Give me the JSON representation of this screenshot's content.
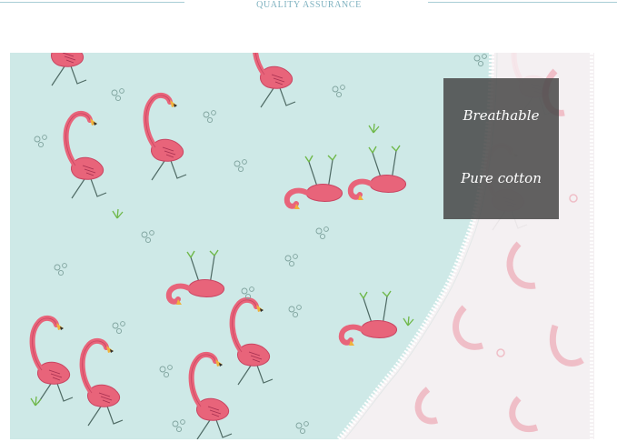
{
  "header": {
    "title": "QUALITY  ASSURANCE"
  },
  "photo": {
    "subject": "flamingo-print-cotton-fabric",
    "colors": {
      "fabric": "#cfeae8",
      "flamingo": "#e8647a",
      "flamingo_dark": "#c94562",
      "beak": "#f0b23c",
      "leaf": "#6fb84a",
      "sheer": "#f6f0f2",
      "stitch": "#ffffff"
    }
  },
  "features": {
    "breathable": "Breathable",
    "pure_cotton": "Pure cotton"
  }
}
